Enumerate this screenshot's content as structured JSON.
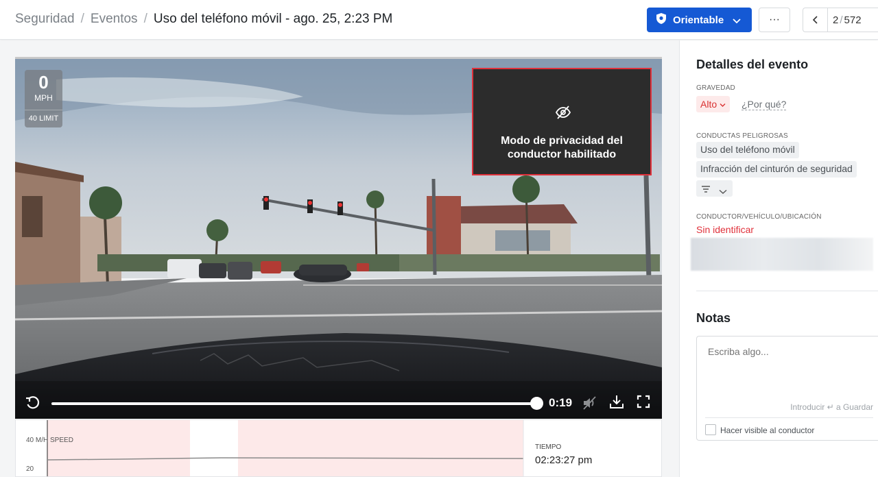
{
  "breadcrumb": {
    "items": [
      "Seguridad",
      "Eventos"
    ],
    "current": "Uso del teléfono móvil - ago. 25, 2:23 PM"
  },
  "header": {
    "orient_button_label": "Orientable",
    "more_label": "···",
    "pager_current": "2",
    "pager_total": "572"
  },
  "video": {
    "speed_value": "0",
    "speed_unit": "MPH",
    "speed_limit": "40 LIMIT",
    "privacy_message": "Modo de privacidad del conductor habilitado",
    "time_display": "0:19",
    "progress_fraction": 1.0
  },
  "speed_chart": {
    "y_label": "40 M/H SPEED",
    "y_tick": "20",
    "time_label": "TIEMPO",
    "time_value": "02:23:27 pm"
  },
  "details": {
    "title": "Detalles del evento",
    "severity_label": "GRAVEDAD",
    "severity_value": "Alto",
    "why_link": "¿Por qué?",
    "behaviors_label": "CONDUCTAS PELIGROSAS",
    "behaviors": [
      "Uso del teléfono móvil",
      "Infracción del cinturón de seguridad"
    ],
    "driver_label": "CONDUCTOR/VEHÍCULO/UBICACIÓN",
    "driver_value": "Sin identificar"
  },
  "notes": {
    "title": "Notas",
    "placeholder": "Escriba algo...",
    "hint": "Introducir ↵ a Guardar",
    "visible_label": "Hacer visible al conductor"
  },
  "colors": {
    "primary": "#1559d4",
    "danger": "#e0303a",
    "severity_bg": "#fdeaea",
    "chart_band": "#fde9e9"
  }
}
